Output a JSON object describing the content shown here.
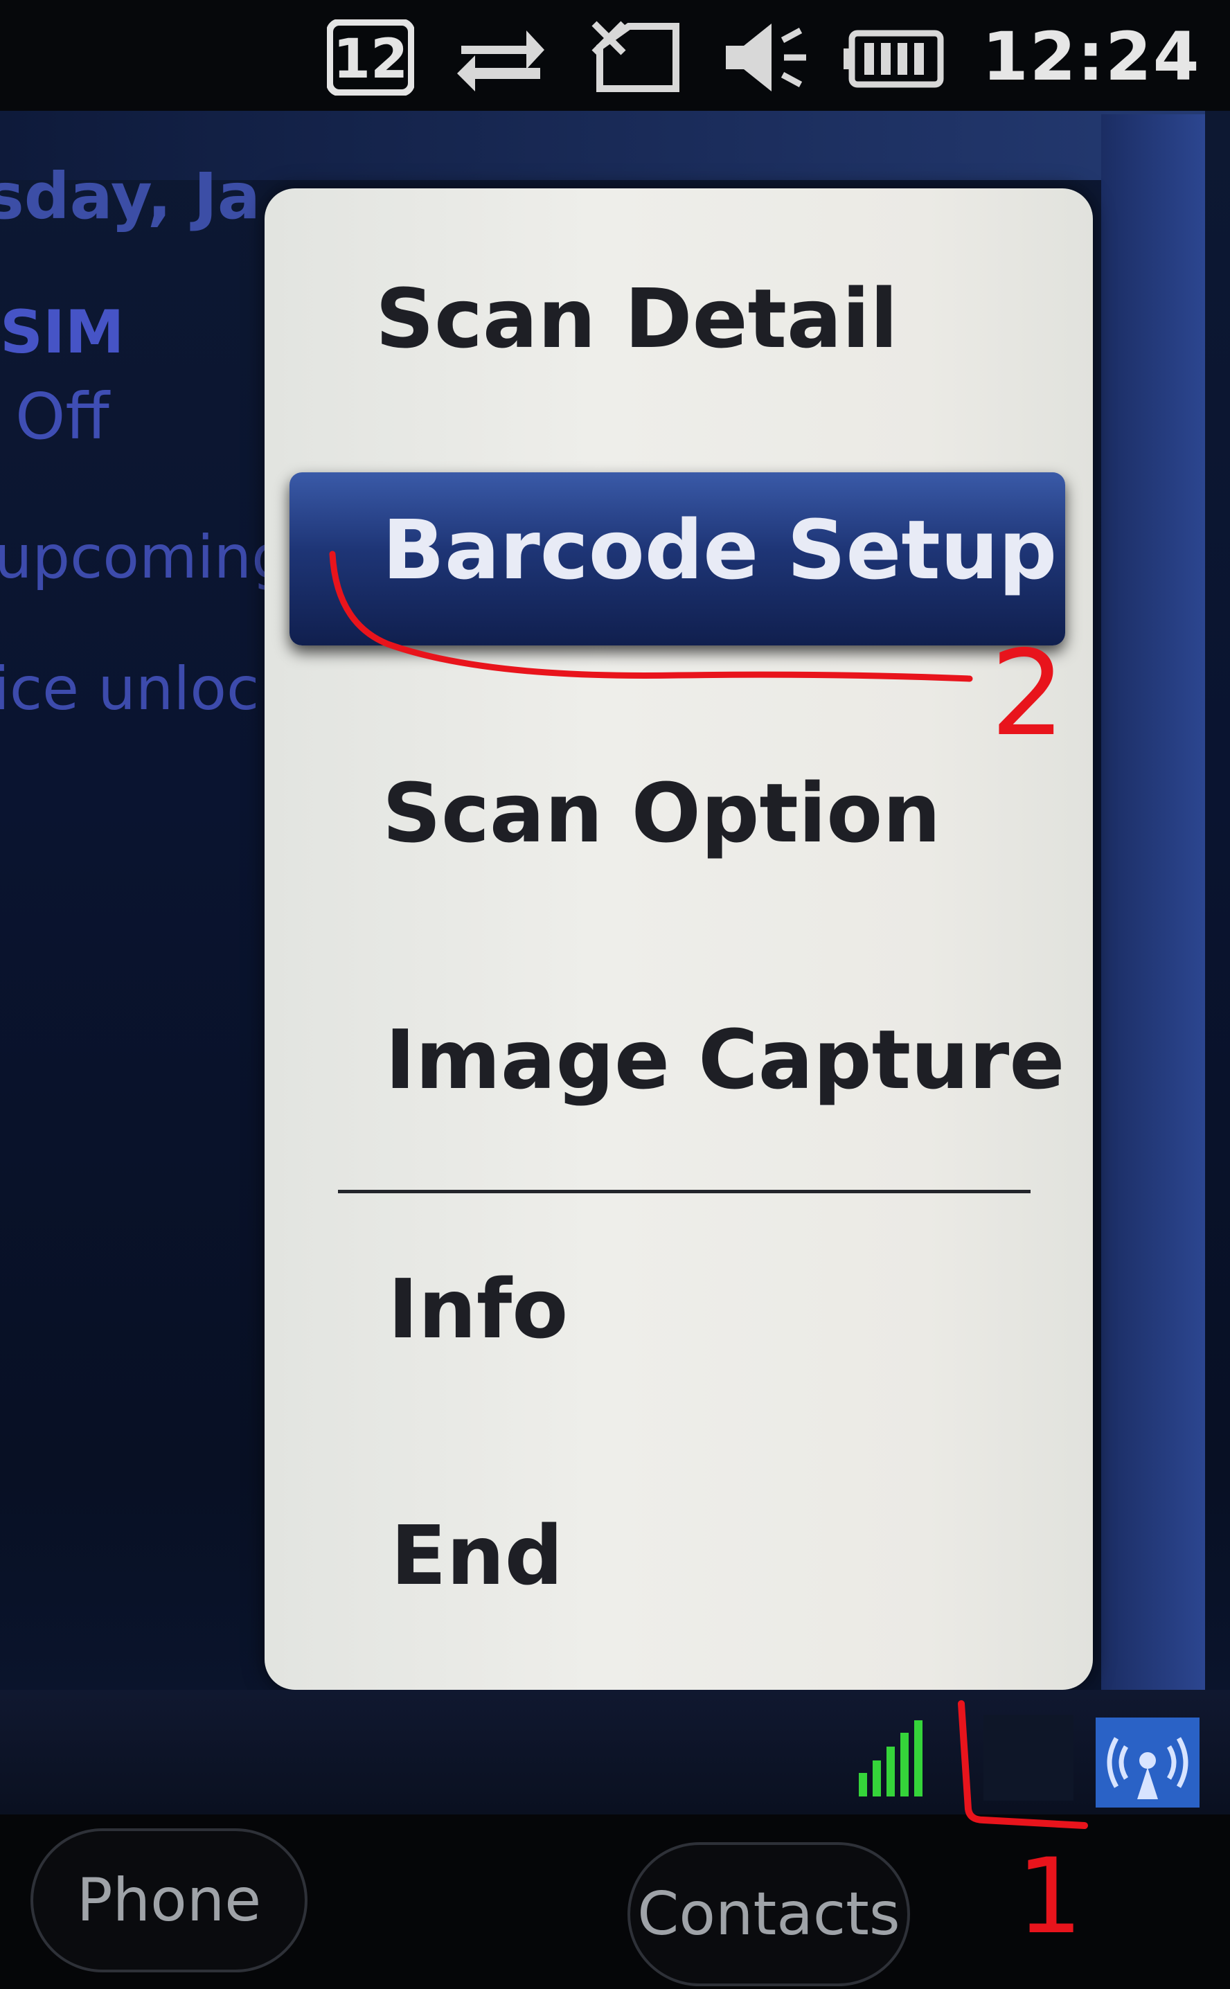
{
  "status_bar": {
    "notification_count": "12",
    "time": "12:24",
    "icons": [
      "notification-count-icon",
      "sync-arrows-icon",
      "no-signal-icon",
      "speaker-icon",
      "battery-icon"
    ]
  },
  "today": {
    "date_text": "sday, Ja",
    "sim_label": "SIM",
    "sim_status": "Off",
    "upcoming_text": "upcoming",
    "unlock_text": "ice unloc"
  },
  "menu": {
    "items": [
      {
        "label": "Scan Detail",
        "selected": false
      },
      {
        "label": "Barcode Setup",
        "selected": true
      },
      {
        "label": "Scan Option",
        "selected": false
      },
      {
        "label": "Image Capture",
        "selected": false
      },
      {
        "label": "Info",
        "selected": false
      },
      {
        "label": "End",
        "selected": false
      }
    ]
  },
  "tray": {
    "icons": [
      "signal-bars-icon",
      "scanner-tray-icon",
      "wireless-tray-icon"
    ]
  },
  "softkeys": {
    "left": "Phone",
    "right": "Contacts"
  },
  "annotations": {
    "marker_1": "1",
    "marker_2": "2",
    "color": "#e8141c"
  },
  "colors": {
    "menu_highlight": "#1e3576",
    "today_text": "#4052b8",
    "signal_green": "#35d43a"
  }
}
